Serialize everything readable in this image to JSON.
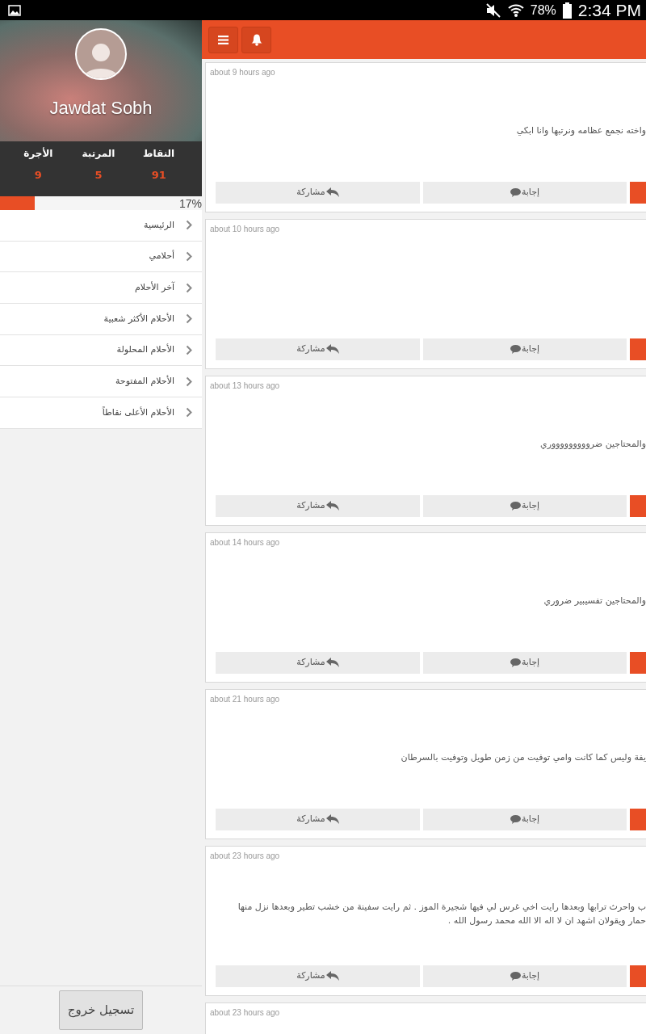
{
  "status_bar": {
    "battery": "78%",
    "time": "2:34 PM"
  },
  "profile": {
    "name": "Jawdat Sobh"
  },
  "stats": [
    {
      "label": "النقاط",
      "value": "91"
    },
    {
      "label": "المرتبة",
      "value": "5"
    },
    {
      "label": "الأجرة",
      "value": "9"
    }
  ],
  "progress": {
    "level": 0.17,
    "reading": "17%"
  },
  "menu": [
    {
      "label": "الرئيسية"
    },
    {
      "label": "أحلامي"
    },
    {
      "label": "آخر الأحلام"
    },
    {
      "label": "الأحلام الأكثر شعبية"
    },
    {
      "label": "الأحلام المحلولة"
    },
    {
      "label": "الأحلام المفتوحة"
    },
    {
      "label": "الأحلام الأعلى نقاطاً"
    }
  ],
  "logout": "تسجيل خروج",
  "posts": [
    {
      "time": "about 9 hours ago",
      "text": [
        "واخته نجمع عظامه ونرتبها وانا ابكي"
      ],
      "answer": "إجابة",
      "share": "مشاركة"
    },
    {
      "time": "about 10 hours ago",
      "answer": "إجابة",
      "share": "مشاركة"
    },
    {
      "time": "about 13 hours ago",
      "text": [
        "والمحتاجين ضروووووووووري"
      ],
      "answer": "إجابة",
      "share": "مشاركة"
    },
    {
      "time": "about 14 hours ago",
      "text": [
        "والمحتاجين تفسيبير ضروري"
      ],
      "answer": "إجابة",
      "share": "مشاركة"
    },
    {
      "time": "about 21 hours ago",
      "text": [
        "يفة وليس كما كانت وامي توفيت من زمن طويل وتوفيت بالسرطان"
      ],
      "answer": "إجابة",
      "share": "مشاركة"
    },
    {
      "time": "about 23 hours ago",
      "text": [
        "ب واحرث ترابها وبعدها رايت اخي غرس لي فيها شجيرة الموز . ثم رايت سفينة من خشب تطير وبعدها نزل منها",
        "حمار ويقولان اشهد ان لا اله الا الله محمد رسول الله ."
      ],
      "answer": "إجابة",
      "share": "مشاركة"
    },
    {
      "time": "about 23 hours ago"
    }
  ]
}
